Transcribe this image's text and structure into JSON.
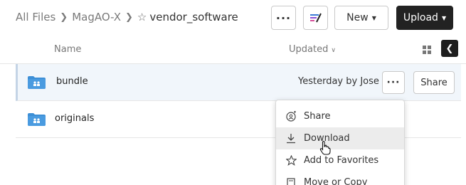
{
  "breadcrumb": {
    "root": "All Files",
    "parent": "MagAO-X",
    "current": "vendor_software"
  },
  "toolbar": {
    "more_label": "···",
    "new_label": "New",
    "upload_label": "Upload"
  },
  "columns": {
    "name": "Name",
    "updated": "Updated"
  },
  "rows": [
    {
      "name": "bundle",
      "updated": "Yesterday by Jose",
      "share_label": "Share",
      "more_label": "···"
    },
    {
      "name": "originals"
    }
  ],
  "menu": {
    "items": [
      {
        "label": "Share",
        "icon": "share-person-icon"
      },
      {
        "label": "Download",
        "icon": "download-icon"
      },
      {
        "label": "Add to Favorites",
        "icon": "star-icon"
      },
      {
        "label": "Move or Copy",
        "icon": "move-icon"
      }
    ]
  },
  "colors": {
    "folder": "#3d8fd6",
    "upload_bg": "#222222",
    "selected_row_bg": "#f1f6fb",
    "menu_hover": "#ececec"
  }
}
